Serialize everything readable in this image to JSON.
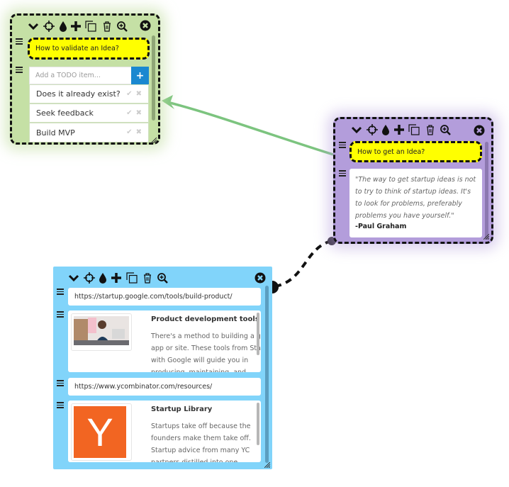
{
  "colors": {
    "green_card": "#c5e0a5",
    "purple_card": "#b39ddb",
    "blue_card": "#81d4fa",
    "title_highlight": "#ffff00",
    "add_button": "#1a88d0",
    "arrow_green": "#7cc47f",
    "yc_orange": "#f26522"
  },
  "toolbar_icons": [
    "collapse-chevron-icon",
    "move-crosshair-icon",
    "color-drop-icon",
    "add-plus-icon",
    "duplicate-icon",
    "trash-icon",
    "zoom-in-icon",
    "close-icon"
  ],
  "cards": {
    "green": {
      "title": "How to validate an Idea?",
      "todo_placeholder": "Add a TODO item...",
      "add_label": "+",
      "items": [
        {
          "text": "Does it already exist?",
          "actions": "✔ ✖"
        },
        {
          "text": "Seek feedback",
          "actions": "✔ ✖"
        },
        {
          "text": "Build MVP",
          "actions": "✔ ✖"
        }
      ]
    },
    "purple": {
      "title": "How to get an Idea?",
      "quote": "\"The way to get startup ideas is not to try to think of startup ideas. It's to look for problems, preferably problems you have yourself.\"",
      "author": "-Paul Graham"
    },
    "blue": {
      "links": [
        {
          "url": "https://startup.google.com/tools/build-product/",
          "title": "Product development tools",
          "description": "There's a method to building a good app or site. These tools from Startup with Google will guide you in producing, maintaining, and evolving"
        },
        {
          "url": "https://www.ycombinator.com/resources/",
          "title": "Startup Library",
          "description": "Startups take off because the founders make them take off. Startup advice from many YC partners distilled into one document. Build",
          "logo_letter": "Y"
        }
      ]
    }
  }
}
